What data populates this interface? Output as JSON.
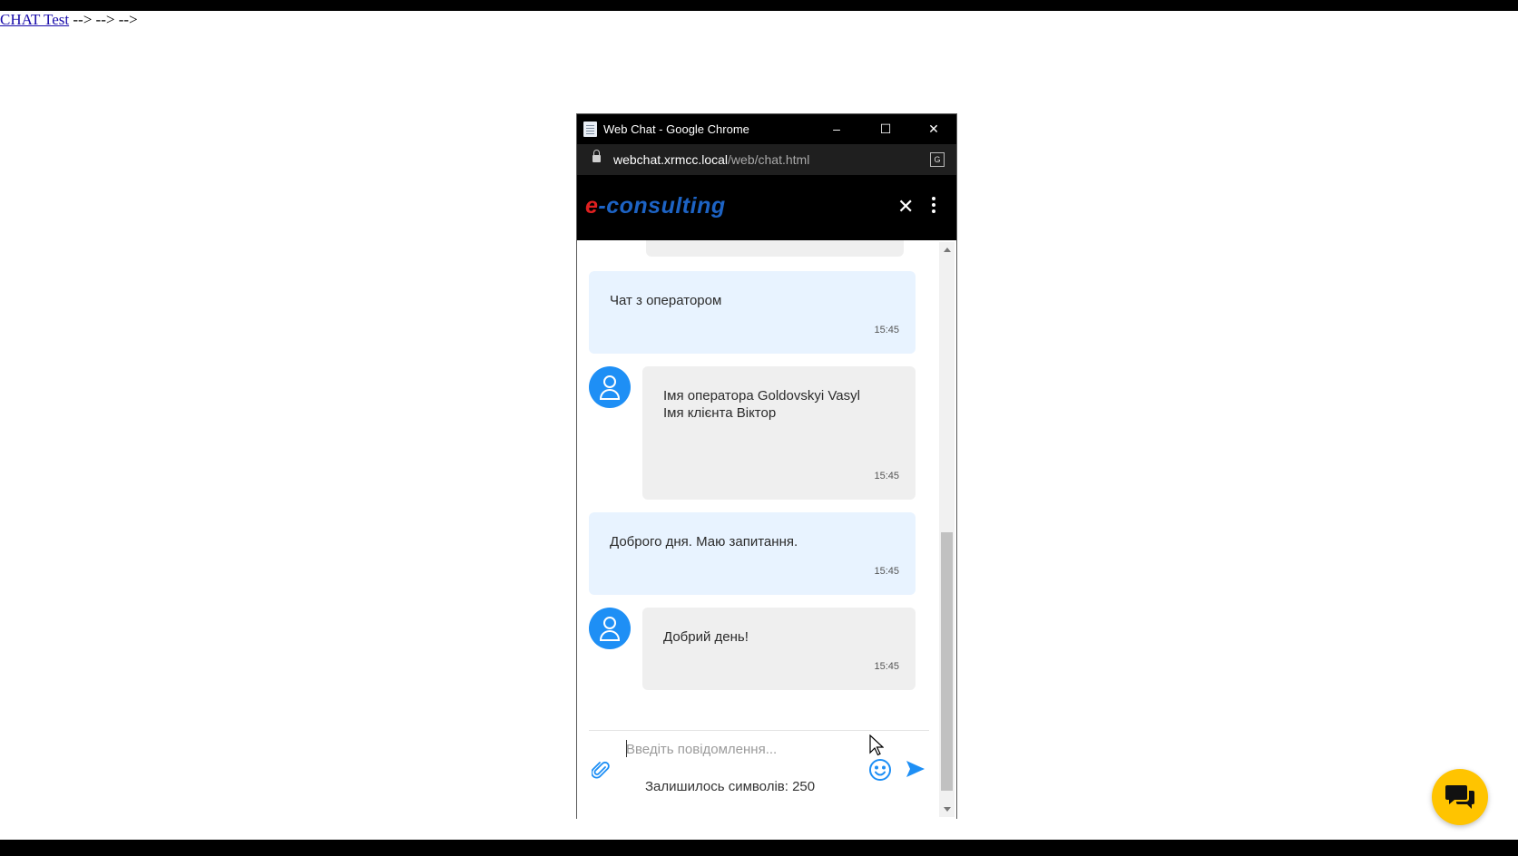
{
  "page": {
    "link_text": "CHAT Test",
    "arrows_text": " --> --> -->"
  },
  "browser": {
    "window_title": "Web Chat - Google Chrome",
    "minimize_label": "–",
    "maximize_label": "☐",
    "close_label": "✕",
    "url_host": "webchat.xrmcc.local",
    "url_path": "/web/chat.html"
  },
  "header": {
    "logo_e": "e",
    "logo_rest": "-consulting",
    "close_label": "✕"
  },
  "messages": [
    {
      "sender": "client",
      "text": "Чат з оператором",
      "time": "15:45"
    },
    {
      "sender": "operator",
      "text": "Імя оператора Goldovskyi Vasyl\nІмя клієнта Віктор",
      "time": "15:45"
    },
    {
      "sender": "client",
      "text": "Доброго дня. Маю запитання.",
      "time": "15:45"
    },
    {
      "sender": "operator",
      "text": "Добрий день!",
      "time": "15:45"
    }
  ],
  "composer": {
    "placeholder": "Введіть повідомлення...",
    "remaining_label": "Залишилось символів:",
    "remaining_count": "250"
  },
  "icons": {
    "attach": "paperclip-icon",
    "emoji": "smile-icon",
    "send": "send-icon",
    "avatar": "user-icon",
    "fab": "chat-bubbles-icon"
  },
  "colors": {
    "brand_red": "#e02020",
    "brand_blue": "#1d63c4",
    "accent_blue": "#1e8ff5",
    "client_bubble": "#e8f3ff",
    "operator_bubble": "#efefef",
    "fab_yellow": "#ffc400"
  }
}
